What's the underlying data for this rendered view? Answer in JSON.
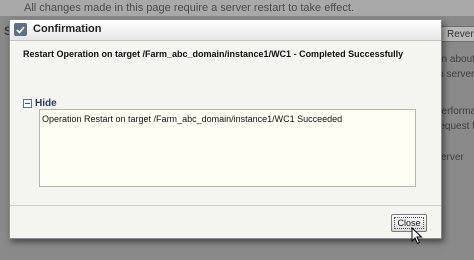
{
  "background": {
    "notice": "All changes made in this page require a server restart to take effect.",
    "section_letter": "S",
    "revert_label": "Revert",
    "side_lines": [
      "on about t",
      "in server",
      "",
      "performa",
      "request f",
      "",
      "server"
    ]
  },
  "dialog": {
    "title": "Confirmation",
    "message": "Restart Operation on target /Farm_abc_domain/instance1/WC1 - Completed Successfully",
    "hide_label": "Hide",
    "details": "Operation Restart  on target /Farm_abc_domain/instance1/WC1  Succeeded",
    "close_label": "Close"
  }
}
